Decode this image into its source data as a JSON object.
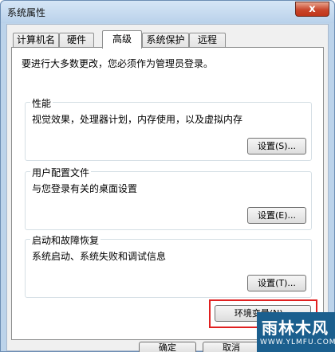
{
  "window": {
    "title": "系统属性",
    "close_glyph": "x"
  },
  "tabs": [
    {
      "label": "计算机名"
    },
    {
      "label": "硬件"
    },
    {
      "label": "高级"
    },
    {
      "label": "系统保护"
    },
    {
      "label": "远程"
    }
  ],
  "active_tab": "高级",
  "panel": {
    "admin_note": "要进行大多数更改，您必须作为管理员登录。",
    "performance": {
      "title": "性能",
      "desc": "视觉效果，处理器计划，内存使用，以及虚拟内存",
      "button": "设置(S)..."
    },
    "user_profiles": {
      "title": "用户配置文件",
      "desc": "与您登录有关的桌面设置",
      "button": "设置(E)..."
    },
    "startup_recovery": {
      "title": "启动和故障恢复",
      "desc": "系统启动、系统失败和调试信息",
      "button": "设置(T)..."
    },
    "env_button": "环境变量(N)..."
  },
  "footer": {
    "ok": "确定",
    "cancel": "取消"
  },
  "watermark": {
    "main": "雨林木风",
    "sub": "WWW.YLMFU.COM"
  }
}
